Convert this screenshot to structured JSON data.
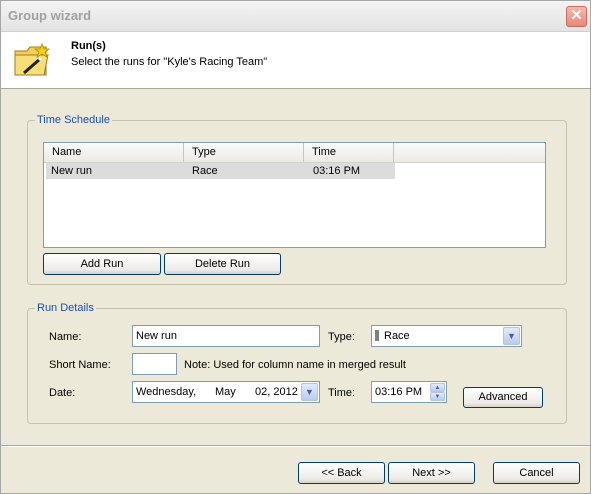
{
  "window": {
    "title": "Group wizard",
    "close_symbol": "✕"
  },
  "header": {
    "title": "Run(s)",
    "subtitle": "Select the runs for \"Kyle's Racing Team\""
  },
  "time_schedule": {
    "legend": "Time Schedule",
    "columns": [
      "Name",
      "Type",
      "Time"
    ],
    "rows": [
      {
        "name": "New run",
        "type": "Race",
        "time": "03:16 PM"
      }
    ],
    "add_run_label": "Add Run",
    "delete_run_label": "Delete Run"
  },
  "run_details": {
    "legend": "Run Details",
    "name_label": "Name:",
    "name_value": "New run",
    "type_label": "Type:",
    "type_value": "Race",
    "short_name_label": "Short Name:",
    "short_name_value": "",
    "short_name_note": "Note: Used for column name in merged result",
    "date_label": "Date:",
    "date_weekday": "Wednesday,",
    "date_month": "May",
    "date_daynum": "02, 2012",
    "time_label": "Time:",
    "time_value": "03:16 PM",
    "advanced_label": "Advanced"
  },
  "footer": {
    "back_label": "<< Back",
    "next_label": "Next >>",
    "cancel_label": "Cancel"
  }
}
